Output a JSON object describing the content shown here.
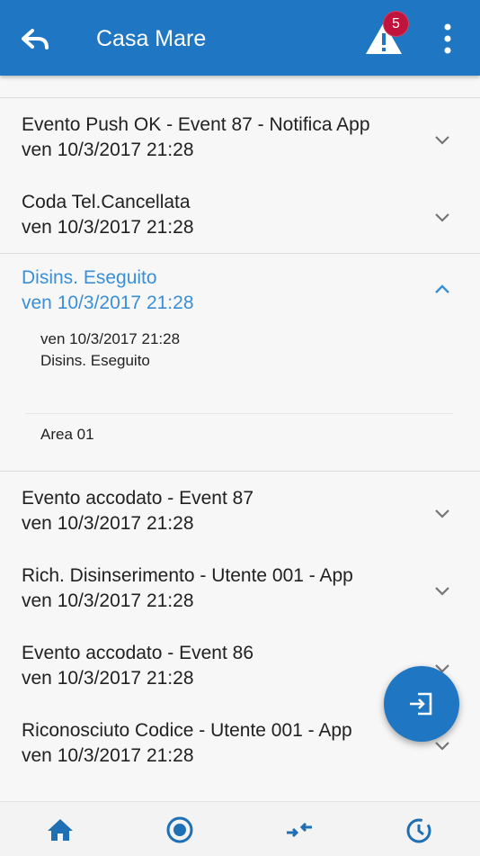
{
  "header": {
    "title": "Casa Mare",
    "alert_count": "5"
  },
  "events": [
    {
      "title": "Evento Push OK - Event 87 - Notifica App",
      "date": "ven 10/3/2017 21:28"
    },
    {
      "title": "Coda Tel.Cancellata",
      "date": "ven 10/3/2017 21:28"
    },
    {
      "title": "Disins. Eseguito",
      "date": "ven 10/3/2017 21:28",
      "detail": {
        "date": "ven 10/3/2017 21:28",
        "description": "Disins. Eseguito",
        "area": "Area 01"
      }
    },
    {
      "title": "Evento accodato - Event 87",
      "date": "ven 10/3/2017 21:28"
    },
    {
      "title": "Rich. Disinserimento - Utente 001 - App",
      "date": "ven 10/3/2017 21:28"
    },
    {
      "title": "Evento accodato - Event 86",
      "date": "ven 10/3/2017 21:28"
    },
    {
      "title": "Riconosciuto Codice - Utente 001 - App",
      "date": "ven 10/3/2017 21:28"
    }
  ],
  "colors": {
    "primary": "#1f76c2",
    "active_text": "#3a8fd6",
    "badge": "#c0143c"
  }
}
